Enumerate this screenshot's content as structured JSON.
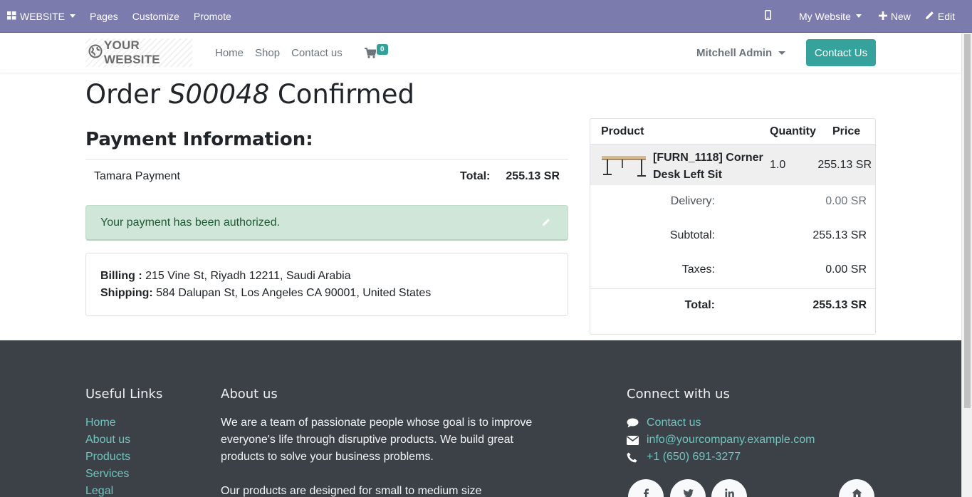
{
  "adminbar": {
    "website_menu": "WEBSITE",
    "pages": "Pages",
    "customize": "Customize",
    "promote": "Promote",
    "my_website": "My Website",
    "new": "New",
    "edit": "Edit"
  },
  "header": {
    "logo_text": "YOUR WEBSITE",
    "nav": [
      "Home",
      "Shop",
      "Contact us"
    ],
    "cart_count": "0",
    "user_name": "Mitchell Admin",
    "contact_button": "Contact Us"
  },
  "order": {
    "title_prefix": "Order",
    "order_number": "S00048",
    "title_suffix": "Confirmed"
  },
  "payment": {
    "heading": "Payment Information:",
    "method": "Tamara Payment",
    "total_label": "Total:",
    "total_value": "255.13 SR",
    "alert": "Your payment has been authorized."
  },
  "address": {
    "billing_label": "Billing :",
    "billing_value": "215 Vine St, Riyadh 12211, Saudi Arabia",
    "shipping_label": "Shipping:",
    "shipping_value": "584 Dalupan St, Los Angeles CA 90001, United States"
  },
  "summary": {
    "headers": {
      "product": "Product",
      "quantity": "Quantity",
      "price": "Price"
    },
    "product": {
      "name": "[FURN_1118] Corner Desk Left Sit",
      "quantity": "1.0",
      "price": "255.13 SR"
    },
    "delivery_label": "Delivery:",
    "delivery_value": "0.00 SR",
    "subtotal_label": "Subtotal:",
    "subtotal_value": "255.13 SR",
    "taxes_label": "Taxes:",
    "taxes_value": "0.00 SR",
    "total_label": "Total:",
    "total_value": "255.13 SR"
  },
  "footer": {
    "useful_links_heading": "Useful Links",
    "useful_links": [
      "Home",
      "About us",
      "Products",
      "Services",
      "Legal"
    ],
    "about_heading": "About us",
    "about_p1": "We are a team of passionate people whose goal is to improve everyone's life through disruptive products. We build great products to solve your business problems.",
    "about_p2": "Our products are designed for small to medium size",
    "connect_heading": "Connect with us",
    "contact_link": "Contact us",
    "email": "info@yourcompany.example.com",
    "phone": "+1 (650) 691-3277"
  },
  "colors": {
    "adminbar": "#7c7bad",
    "primary": "#35a29c",
    "footer_bg": "#3c4147",
    "alert_bg": "#cfe6d8"
  },
  "icons": [
    "apps-icon",
    "mobile-icon",
    "plus-icon",
    "pencil-icon",
    "globe-icon",
    "cart-icon",
    "comment-icon",
    "envelope-icon",
    "phone-icon",
    "facebook-icon",
    "twitter-icon",
    "linkedin-icon",
    "home-icon"
  ]
}
